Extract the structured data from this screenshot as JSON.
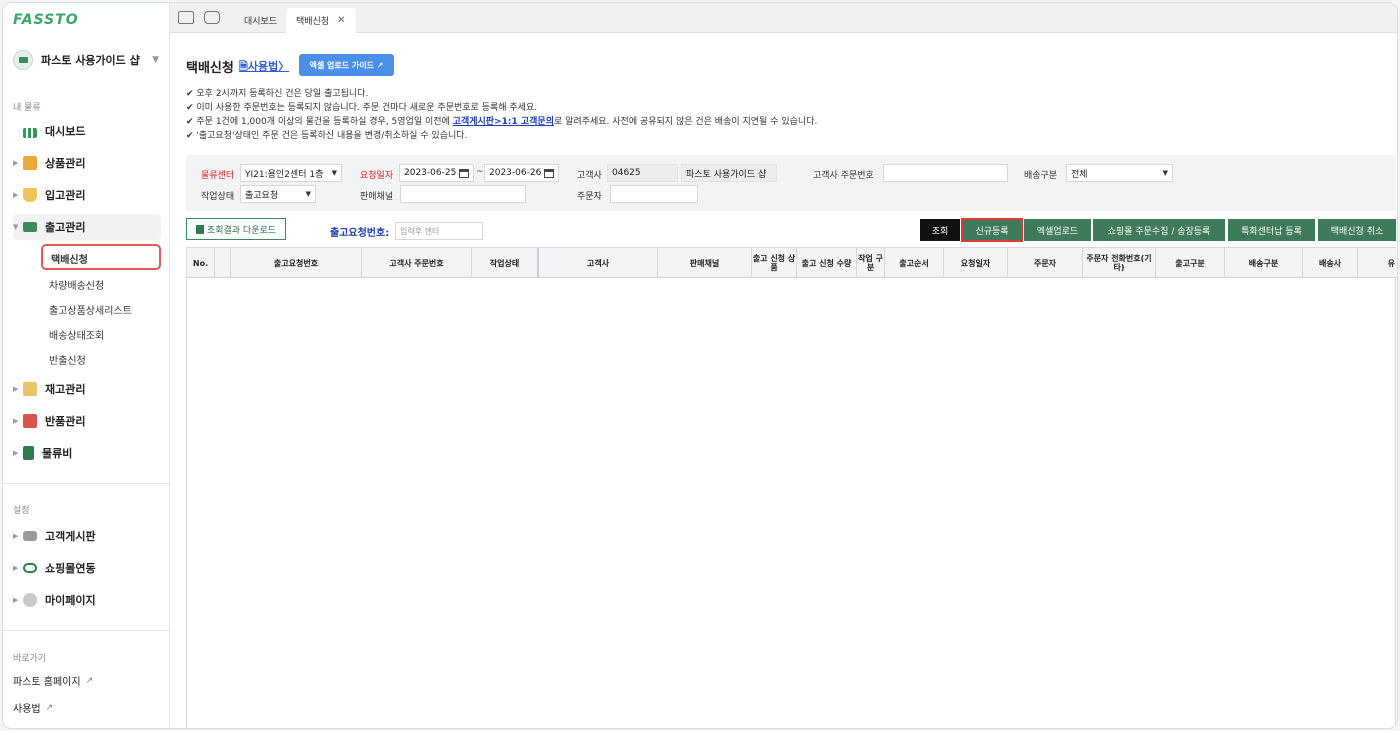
{
  "app": {
    "logo": "FASSTO"
  },
  "sidebar": {
    "shop_name": "파스토 사용가이드 샵",
    "section_main": "내 물류",
    "items": [
      {
        "label": "대시보드",
        "icon": "bar-chart-icon"
      },
      {
        "label": "상품관리",
        "icon": "box-icon"
      },
      {
        "label": "입고관리",
        "icon": "cart-icon"
      },
      {
        "label": "출고관리",
        "icon": "truck-icon"
      },
      {
        "label": "재고관리",
        "icon": "stock-icon"
      },
      {
        "label": "반품관리",
        "icon": "return-icon"
      },
      {
        "label": "물류비",
        "icon": "book-icon"
      }
    ],
    "sub_items": [
      "택배신청",
      "차량배송신청",
      "출고상품상세리스트",
      "배송상태조회",
      "반출신청"
    ],
    "section_settings": "설정",
    "settings_items": [
      {
        "label": "고객게시판",
        "icon": "chat-icon"
      },
      {
        "label": "쇼핑몰연동",
        "icon": "link-icon"
      },
      {
        "label": "마이페이지",
        "icon": "user-icon"
      }
    ],
    "section_links": "바로가기",
    "links": [
      "파스토 홈페이지",
      "사용법"
    ]
  },
  "tabs": [
    {
      "label": "대시보드"
    },
    {
      "label": "택배신청"
    }
  ],
  "page": {
    "title": "택배신청",
    "howto": "사용법",
    "guide_button": "엑셀 업로드 가이드 ↗",
    "notes": [
      "✔ 오후 2시까지 등록하신 건은 당일 출고됩니다.",
      "✔ 이미 사용한 주문번호는 등록되지 않습니다. 주문 건마다 새로운 주문번호로 등록해 주세요.",
      "✔ 주문 1건에 1,000개 이상의 물건을 등록하실 경우, 5영업일 이전에 ",
      "✔ '출고요청'상태인 주문 건은 등록하신 내용을 변경/취소하실 수 있습니다."
    ],
    "note_link": "고객게시판>1:1 고객문의",
    "note_tail": "로 알려주세요. 사전에 공유되지 않은 건은 배송이 지연될 수 있습니다."
  },
  "filters": {
    "center_label": "물류센터",
    "center_value": "YI21:용인2센터 1층",
    "date_label": "요청일자",
    "date_from": "2023-06-25",
    "date_sep": "~",
    "date_to": "2023-06-26",
    "client_label": "고객사",
    "client_code": "04625",
    "client_name": "파스토 사용가이드 샵",
    "order_no_label": "고객사 주문번호",
    "ship_type_label": "배송구분",
    "ship_type_value": "전체",
    "work_status_label": "작업상태",
    "work_status_value": "출고요청",
    "channel_label": "판매채널",
    "orderer_label": "주문자"
  },
  "toolbar": {
    "download": "조회결과 다운로드",
    "reqno_label": "출고요청번호:",
    "reqno_placeholder": "입력후 엔터",
    "buttons": [
      "조회",
      "신규등록",
      "엑셀업로드",
      "쇼핑몰 주문수집 / 송장등록",
      "특화센터납 등록",
      "택배신청 취소"
    ]
  },
  "grid": {
    "columns": [
      "No.",
      "",
      "출고요청번호",
      "고객사 주문번호",
      "작업상태",
      "고객사",
      "판매채널",
      "출고 신청 상품",
      "출고 신청 수량",
      "작업 구분",
      "출고순서",
      "요청일자",
      "주문자",
      "주문자 전화번호(기타)",
      "출고구분",
      "배송구분",
      "배송사",
      "유"
    ]
  }
}
